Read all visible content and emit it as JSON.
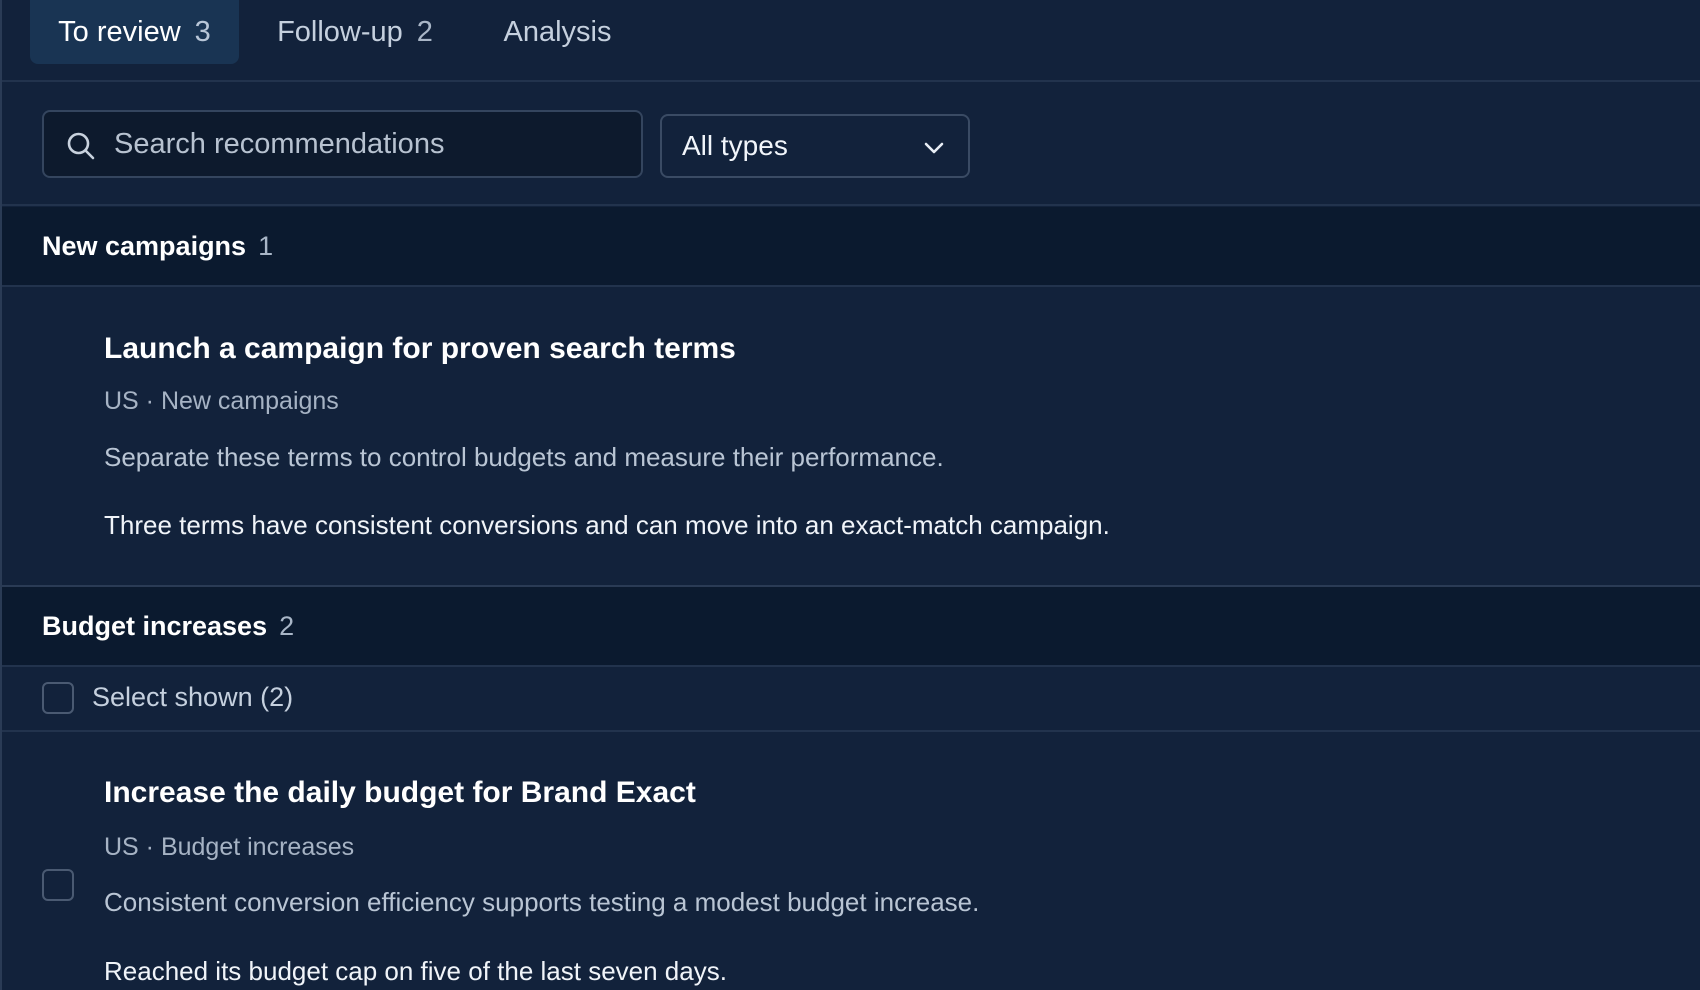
{
  "tabs": [
    {
      "label": "To review",
      "count": "3",
      "active": true
    },
    {
      "label": "Follow-up",
      "count": "2",
      "active": false
    },
    {
      "label": "Analysis",
      "count": "",
      "active": false
    }
  ],
  "search": {
    "placeholder": "Search recommendations",
    "value": ""
  },
  "type_filter": {
    "selected": "All types"
  },
  "sections": [
    {
      "title": "New campaigns",
      "count": "1",
      "items": [
        {
          "title": "Launch a campaign for proven search terms",
          "meta": "US · New campaigns",
          "description": "Separate these terms to control budgets and measure their performance.",
          "reason": "Three terms have consistent conversions and can move into an exact-match campaign."
        }
      ]
    },
    {
      "title": "Budget increases",
      "count": "2",
      "select_all_label": "Select shown (2)",
      "items": [
        {
          "title": "Increase the daily budget for Brand Exact",
          "meta": "US · Budget increases",
          "description": "Consistent conversion efficiency supports testing a modest budget increase.",
          "reason": "Reached its budget cap on five of the last seven days."
        }
      ]
    }
  ],
  "icons": {
    "search": "search-icon",
    "dropdown": "chevron-down-icon"
  },
  "colors": {
    "background": "#12223b",
    "section_header": "#0b1a2f",
    "active_tab": "#193453"
  }
}
